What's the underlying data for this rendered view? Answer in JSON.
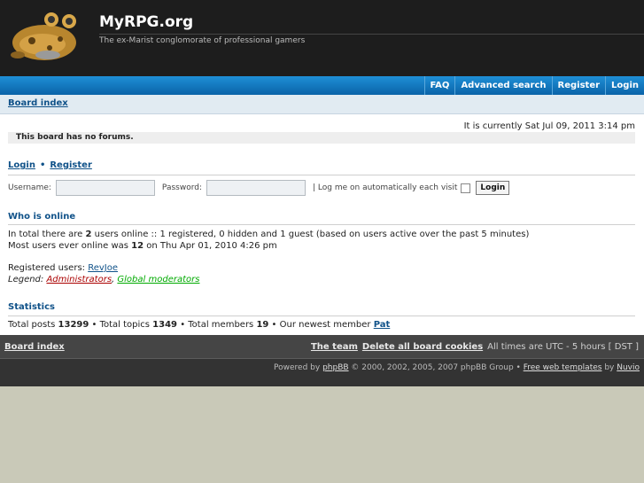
{
  "header": {
    "site_title": "MyRPG.org",
    "site_description": "The ex-Marist conglomorate of professional gamers"
  },
  "nav": {
    "faq": "FAQ",
    "advanced_search": "Advanced search",
    "register": "Register",
    "login": "Login"
  },
  "breadcrumb": {
    "board_index": "Board index"
  },
  "main": {
    "current_time": "It is currently Sat Jul 09, 2011 3:14 pm",
    "no_forums": "This board has no forums."
  },
  "login": {
    "login_link": "Login",
    "separator": "•",
    "register_link": "Register",
    "username_label": "Username:",
    "password_label": "Password:",
    "autologin_label": "| Log me on automatically each visit",
    "login_button": "Login"
  },
  "who_is_online": {
    "title": "Who is online",
    "line1_pre": "In total there are ",
    "user_count": "2",
    "line1_post": " users online :: 1 registered, 0 hidden and 1 guest (based on users active over the past 5 minutes)",
    "line2_pre": "Most users ever online was ",
    "max_users": "12",
    "line2_post": " on Thu Apr 01, 2010 4:26 pm",
    "registered_label": "Registered users: ",
    "registered_user": "RevJoe",
    "legend_label": "Legend: ",
    "legend_admins": "Administrators",
    "legend_comma": ",",
    "legend_mods": "Global moderators"
  },
  "statistics": {
    "title": "Statistics",
    "posts_label": "Total posts ",
    "posts": "13299",
    "topics_label": " • Total topics ",
    "topics": "1349",
    "members_label": " • Total members ",
    "members": "19",
    "newest_label": " • Our newest member ",
    "newest_member": "Pat"
  },
  "footer": {
    "board_index": "Board index",
    "the_team": "The team",
    "delete_cookies": "Delete all board cookies",
    "timezone": "All times are UTC - 5 hours [ DST ]",
    "powered_by": "Powered by ",
    "phpbb": "phpBB",
    "copyright": " © 2000, 2002, 2005, 2007 phpBB Group • ",
    "templates": "Free web templates",
    "by": " by ",
    "nuvio": "Nuvio"
  },
  "colors": {
    "nav_blue": "#0a63a8",
    "link_blue": "#105289",
    "admin_red": "#aa0000",
    "mod_green": "#00aa00"
  }
}
